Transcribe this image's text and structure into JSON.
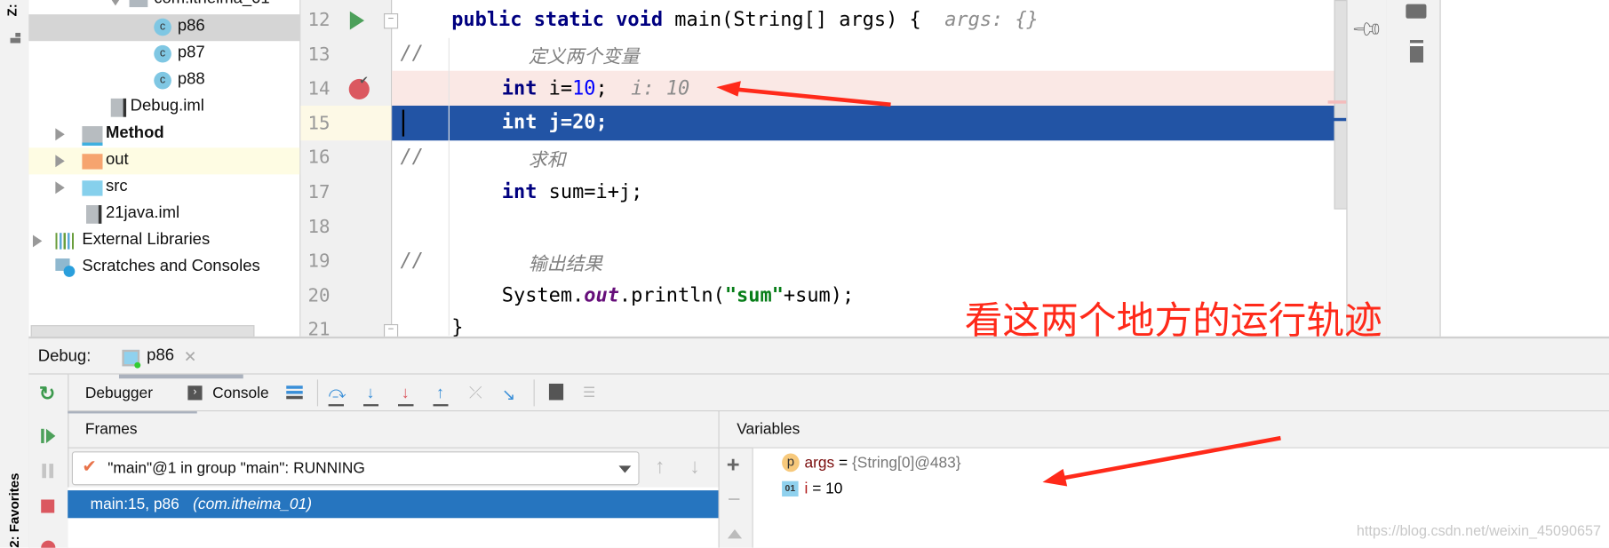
{
  "left_strip": {
    "structure_label": "Z: S",
    "favorites_label": "2: Favorites"
  },
  "project_tree": {
    "items": [
      {
        "label": "com.itheima_01",
        "type": "package"
      },
      {
        "label": "p86",
        "type": "class",
        "selected": true
      },
      {
        "label": "p87",
        "type": "class"
      },
      {
        "label": "p88",
        "type": "class"
      },
      {
        "label": "Debug.iml",
        "type": "file"
      },
      {
        "label": "Method",
        "type": "module"
      },
      {
        "label": "out",
        "type": "folder"
      },
      {
        "label": "src",
        "type": "folder"
      },
      {
        "label": "21java.iml",
        "type": "file"
      },
      {
        "label": "External Libraries",
        "type": "libraries"
      },
      {
        "label": "Scratches and Consoles",
        "type": "scratches"
      }
    ]
  },
  "editor": {
    "line_numbers": [
      "12",
      "13",
      "14",
      "15",
      "16",
      "17",
      "18",
      "19",
      "20",
      "21"
    ],
    "line12": {
      "code": "public static void main(String[] args) {",
      "hint": "args: {}"
    },
    "line13": {
      "slashes": "//",
      "comment": "定义两个变量"
    },
    "line14": {
      "kw": "int",
      "pre": " i=",
      "num": "10",
      ";": ";",
      "hint": "i: 10"
    },
    "line15": {
      "code": "int j=20;"
    },
    "line16": {
      "slashes": "//",
      "comment": "求和"
    },
    "line17": {
      "kw": "int",
      "rest": " sum=i+j;"
    },
    "line19": {
      "slashes": "//",
      "comment": "输出结果"
    },
    "line20": {
      "a": "System.",
      "field": "out",
      "b": ".println(",
      "str": "\"sum\"",
      "c": "+sum);"
    },
    "line21": {
      "code": "}"
    }
  },
  "annotation": {
    "text": "看这两个地方的运行轨迹",
    "color": "#ff2a1a"
  },
  "debug": {
    "title": "Debug:",
    "tab_label": "p86",
    "tabs": {
      "debugger": "Debugger",
      "console": "Console"
    },
    "frames_header": "Frames",
    "variables_header": "Variables",
    "thread_select": "\"main\"@1 in group \"main\": RUNNING",
    "frame": {
      "text": "main:15, p86 ",
      "package": "(com.itheima_01)"
    },
    "variables": [
      {
        "icon": "p",
        "name": "args",
        "eq": " = ",
        "value": "{String[0]@483}"
      },
      {
        "icon": "01",
        "name": "i",
        "eq": " = ",
        "value": "10"
      }
    ]
  },
  "watermark": "https://blog.csdn.net/weixin_45090657",
  "colors": {
    "selection": "#2254a5",
    "breakpoint_line": "#fae8e5",
    "frame_selected": "#2675bf",
    "arrow": "#ff2a1a"
  }
}
